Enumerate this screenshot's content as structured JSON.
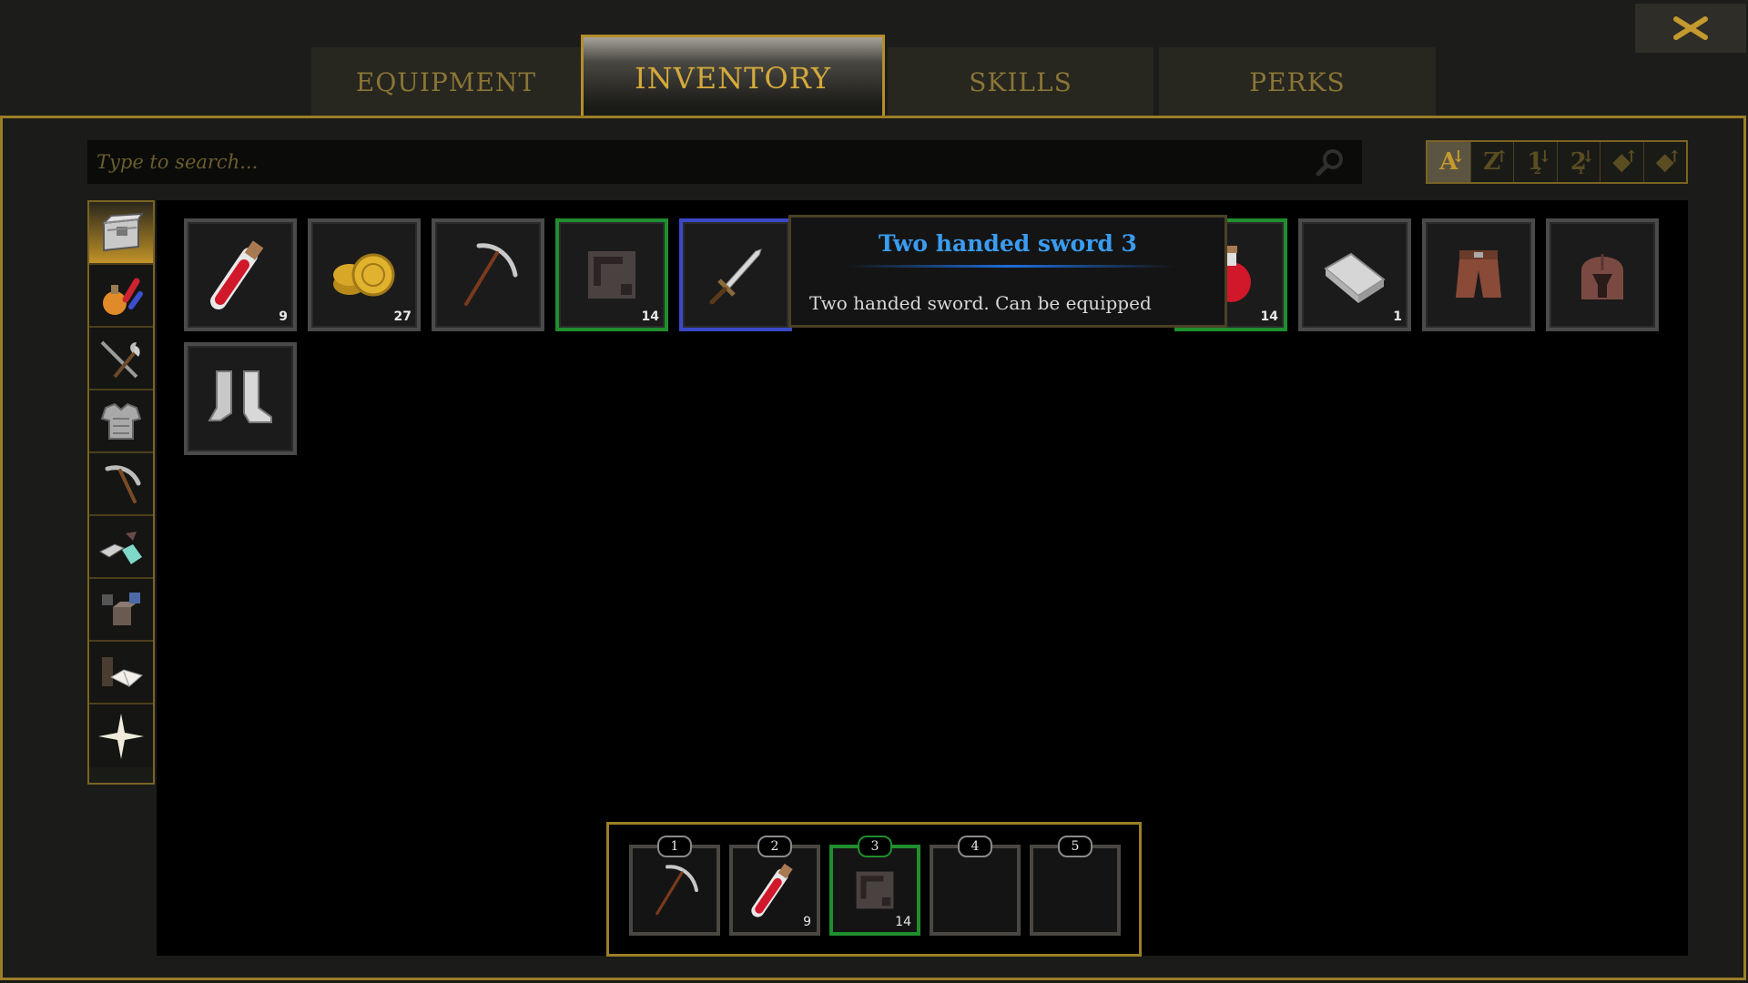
{
  "tabs": [
    {
      "label": "EQUIPMENT"
    },
    {
      "label": "INVENTORY",
      "active": true
    },
    {
      "label": "SKILLS"
    },
    {
      "label": "PERKS"
    }
  ],
  "search": {
    "placeholder": "Type to search...",
    "value": ""
  },
  "sort_buttons": [
    {
      "glyph": "A",
      "icon": "sort-alpha-asc-icon",
      "active": true
    },
    {
      "glyph": "Z",
      "icon": "sort-alpha-desc-icon"
    },
    {
      "glyph": "1",
      "sub": "2",
      "icon": "sort-numeric-asc-icon"
    },
    {
      "glyph": "2",
      "sub": "1",
      "icon": "sort-numeric-desc-icon"
    },
    {
      "glyph": "◆",
      "icon": "sort-value-asc-icon"
    },
    {
      "glyph": "◆",
      "icon": "sort-value-desc-icon"
    }
  ],
  "categories": [
    "chest-all-icon",
    "potion-icon",
    "weapon-icon",
    "armor-icon",
    "tool-icon",
    "material-icon",
    "block-icon",
    "book-icon",
    "star-icon"
  ],
  "inventory": [
    {
      "icon": "red-potion-vial-icon",
      "count": "9"
    },
    {
      "icon": "gold-coins-icon",
      "count": "27"
    },
    {
      "icon": "pickaxe-icon",
      "count": ""
    },
    {
      "icon": "stone-block-icon",
      "count": "14",
      "rarity": "green"
    },
    {
      "icon": "sword-icon",
      "count": "",
      "rarity": "blue"
    },
    {
      "icon": "red-flask-icon",
      "count": "14",
      "rarity": "green"
    },
    {
      "icon": "iron-ingot-icon",
      "count": "1"
    },
    {
      "icon": "leather-pants-icon",
      "count": ""
    },
    {
      "icon": "helmet-icon",
      "count": ""
    },
    {
      "icon": "iron-boots-icon",
      "count": ""
    }
  ],
  "tooltip": {
    "title": "Two handed sword 3",
    "description": "Two handed sword. Can be equipped"
  },
  "hotbar": [
    {
      "key": "1",
      "icon": "pickaxe-icon",
      "count": ""
    },
    {
      "key": "2",
      "icon": "red-potion-vial-icon",
      "count": "9"
    },
    {
      "key": "3",
      "icon": "stone-block-icon",
      "count": "14",
      "rarity": "green"
    },
    {
      "key": "4",
      "icon": "",
      "count": ""
    },
    {
      "key": "5",
      "icon": "",
      "count": ""
    }
  ],
  "colors": {
    "gold_accent": "#9b7e26",
    "rarity_green": "#1f8e2e",
    "rarity_blue": "#3a48c8",
    "tooltip_title": "#3a9cf0"
  }
}
